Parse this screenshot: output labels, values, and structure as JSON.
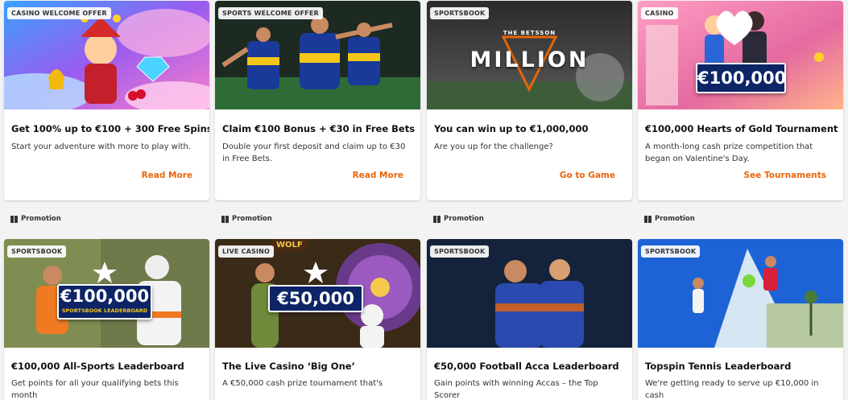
{
  "cards": [
    {
      "badge": "CASINO WELCOME OFFER",
      "title": "Get 100% up to €100 + 300 Free Spins",
      "desc": "Start your adventure with more to play with.",
      "cta": "Read More"
    },
    {
      "badge": "SPORTS WELCOME OFFER",
      "title": "Claim €100 Bonus + €30 in Free Bets",
      "desc": "Double your first deposit and claim up to €30 in Free Bets.",
      "cta": "Read More"
    },
    {
      "badge": "SPORTSBOOK",
      "title": "You can win up to €1,000,000",
      "desc": "Are you up for the challenge?",
      "cta": "Go to Game",
      "art_top": "THE BETSSON",
      "art_main": "MILLION"
    },
    {
      "badge": "CASINO",
      "title": "€100,000 Hearts of Gold Tournament",
      "desc": "A month-long cash prize competition that began on Valentine's Day.",
      "cta": "See Tournaments",
      "prize": "€100,000"
    }
  ],
  "promotions": [
    "Promotion",
    "Promotion",
    "Promotion",
    "Promotion"
  ],
  "cards2": [
    {
      "badge": "SPORTSBOOK",
      "title": "€100,000 All-Sports Leaderboard",
      "desc": "Get points for all your qualifying bets this month",
      "prize": "€100,000",
      "prize_sub": "SPORTSBOOK LEADERBOARD"
    },
    {
      "badge": "LIVE CASINO",
      "title": "The Live Casino ‘Big One’",
      "desc": "A €50,000 cash prize tournament that's",
      "prize": "€50,000",
      "art_label": "WOLF"
    },
    {
      "badge": "SPORTSBOOK",
      "title": "€50,000 Football Acca Leaderboard",
      "desc": "Gain points with winning Accas – the Top Scorer"
    },
    {
      "badge": "SPORTSBOOK",
      "title": "Topspin Tennis Leaderboard",
      "desc": "We're getting ready to serve up €10,000 in cash"
    }
  ],
  "colors": {
    "accent": "#e8650a",
    "plaque": "#0d2466",
    "background": "#f3f3f3"
  }
}
